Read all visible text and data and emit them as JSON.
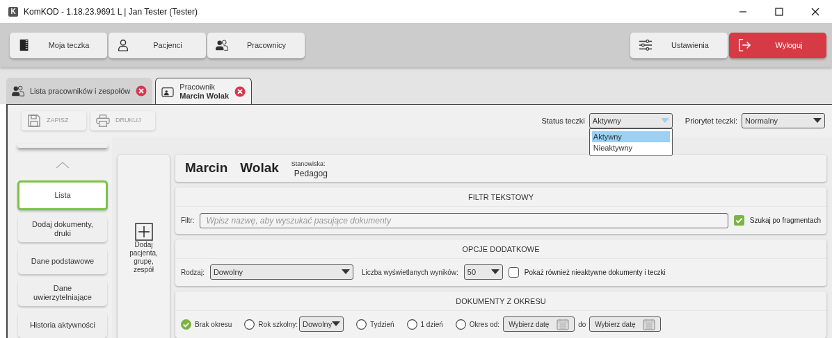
{
  "title_bar": {
    "app_icon": "K",
    "title": "KomKOD - 1.18.23.9691 L | Jan Tester (Tester)"
  },
  "nav_buttons": [
    {
      "label": "Moja teczka",
      "kind": "folder"
    },
    {
      "label": "Pacjenci",
      "kind": "person"
    },
    {
      "label": "Pracownicy",
      "kind": "people"
    }
  ],
  "right_buttons": [
    {
      "label": "Ustawienia",
      "kind": "settings"
    },
    {
      "label": "Wyloguj",
      "kind": "logout"
    }
  ],
  "tabs": [
    {
      "label": "Lista pracowników i zespołów",
      "selected": false
    },
    {
      "label": "Pracownik",
      "sublabel": "Marcin Wolak",
      "selected": true
    }
  ],
  "toolbar": [
    {
      "label": "ZAPISZ",
      "kind": "save",
      "disabled": true
    },
    {
      "label": "DRUKUJ",
      "kind": "print",
      "disabled": true
    }
  ],
  "status": {
    "label": "Status teczki",
    "value": "Aktywny",
    "expanded": true,
    "options": [
      {
        "label": "Aktywny",
        "selected": true
      },
      {
        "label": "Nieaktywny",
        "selected": false
      }
    ]
  },
  "priority": {
    "label": "Priorytet teczki:",
    "value": "Normalny"
  },
  "sidebar": {
    "items": [
      {
        "label": "Lista",
        "selected": true
      },
      {
        "label": "Dodaj dokumenty, druki",
        "selected": false
      },
      {
        "label": "Dane podstawowe",
        "selected": false
      },
      {
        "label": "Dane uwierzytelniające",
        "selected": false
      },
      {
        "label": "Historia aktywności",
        "selected": false
      }
    ]
  },
  "add_button": {
    "label": "Dodaj pacjenta, grupę, zespół"
  },
  "header": {
    "first_name": "Marcin",
    "last_name": "Wolak",
    "position_label": "Stanowiska:",
    "position": "Pedagog"
  },
  "text_filter": {
    "title": "FILTR TEKSTOWY",
    "label": "Filtr:",
    "placeholder": "Wpisz nazwę, aby wyszukać pasujące dokumenty",
    "checkbox": {
      "label": "Szukaj po fragmentach",
      "checked": true
    }
  },
  "extra_options": {
    "title": "OPCJE DODATKOWE",
    "type_label": "Rodzaj:",
    "type_value": "Dowolny",
    "count_label": "Liczba wyświetlanych wyników:",
    "count_value": "50",
    "checkbox": {
      "label": "Pokaż również nieaktywne dokumenty i teczki",
      "checked": false
    }
  },
  "period": {
    "title": "DOKUMENTY Z OKRESU",
    "items": [
      {
        "kind": "radio",
        "label": "Brak okresu",
        "selected": true
      },
      {
        "kind": "radio_select",
        "label": "Rok szkolny:",
        "value": "Dowolny",
        "selected": false
      },
      {
        "kind": "radio",
        "label": "Tydzień",
        "selected": false
      },
      {
        "kind": "radio",
        "label": "1 dzień",
        "selected": false
      },
      {
        "kind": "radio_dates",
        "label": "Okres od:",
        "from": "Wybierz datę",
        "separator": "do",
        "to": "Wybierz datę",
        "selected": false
      }
    ]
  }
}
